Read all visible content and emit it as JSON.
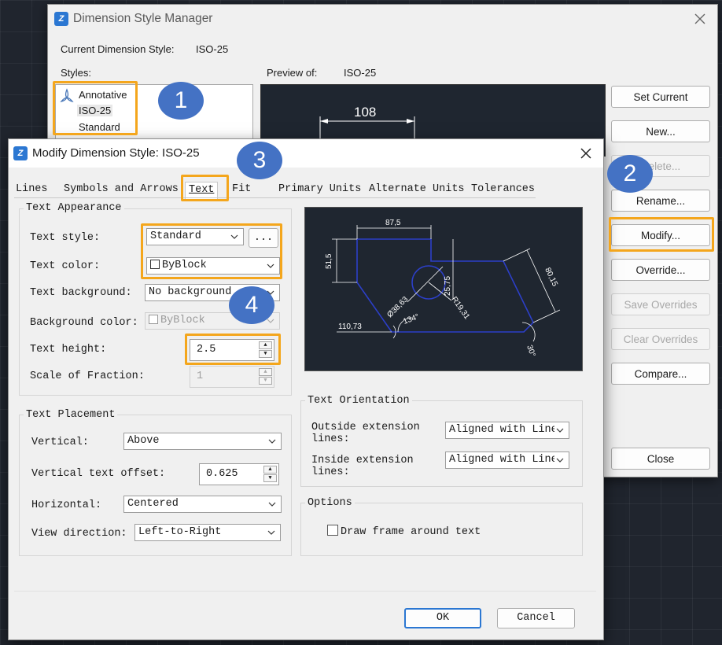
{
  "manager": {
    "title": "Dimension Style Manager",
    "current_label": "Current Dimension Style:",
    "current_value": "ISO-25",
    "styles_label": "Styles:",
    "styles": [
      "Annotative",
      "ISO-25",
      "Standard"
    ],
    "preview_label": "Preview of:",
    "preview_value": "ISO-25",
    "preview_dim": "108",
    "buttons": {
      "set_current": "Set Current",
      "new": "New...",
      "delete": "Delete...",
      "rename": "Rename...",
      "modify": "Modify...",
      "override": "Override...",
      "save_overrides": "Save Overrides",
      "clear_overrides": "Clear Overrides",
      "compare": "Compare...",
      "close": "Close"
    }
  },
  "dialog": {
    "title": "Modify Dimension Style: ISO-25",
    "tabs": [
      "Lines",
      "Symbols and Arrows",
      "Text",
      "Fit",
      "Primary Units",
      "Alternate Units",
      "Tolerances"
    ],
    "active_tab": "Text",
    "text_appearance": {
      "title": "Text Appearance",
      "text_style_label": "Text style:",
      "text_style_value": "Standard",
      "browse_label": "...",
      "text_color_label": "Text color:",
      "text_color_value": "ByBlock",
      "text_background_label": "Text background:",
      "text_background_value": "No background",
      "background_color_label": "Background color:",
      "background_color_value": "ByBlock",
      "text_height_label": "Text height:",
      "text_height_value": "2.5",
      "scale_fraction_label": "Scale of Fraction:",
      "scale_fraction_value": "1"
    },
    "text_placement": {
      "title": "Text Placement",
      "vertical_label": "Vertical:",
      "vertical_value": "Above",
      "offset_label": "Vertical text offset:",
      "offset_value": "0.625",
      "horizontal_label": "Horizontal:",
      "horizontal_value": "Centered",
      "view_direction_label": "View direction:",
      "view_direction_value": "Left-to-Right"
    },
    "text_orientation": {
      "title": "Text Orientation",
      "outside_label_1": "Outside extension",
      "outside_label_2": "lines:",
      "outside_value": "Aligned with Line",
      "inside_label_1": "Inside extension",
      "inside_label_2": "lines:",
      "inside_value": "Aligned with Line"
    },
    "options": {
      "title": "Options",
      "draw_frame_label": "Draw frame around text",
      "draw_frame_checked": false
    },
    "preview": {
      "dims": [
        "87,5",
        "51,5",
        "25,75",
        "80,15",
        "R19,31",
        "Ø38,63",
        "134°",
        "110,73",
        "30°"
      ]
    },
    "ok_label": "OK",
    "cancel_label": "Cancel"
  },
  "annotations": [
    "1",
    "2",
    "3",
    "4"
  ],
  "colors": {
    "highlight": "#f4a61c",
    "badge": "#4472c4",
    "preview_bg": "#1f2630",
    "accent": "#2b77d2"
  }
}
